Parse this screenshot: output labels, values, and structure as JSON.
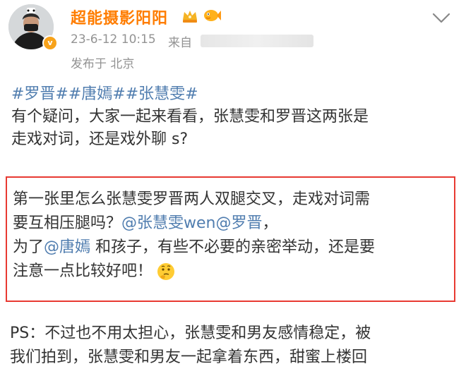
{
  "post": {
    "username": "超能摄影阳阳",
    "time": "23-6-12 10:15",
    "source_prefix": "来自",
    "location": "发布于 北京",
    "verified_mark": "v"
  },
  "content": {
    "topics": [
      "#罗晋#",
      "#唐嫣#",
      "#张慧雯#"
    ],
    "line1": "有个疑问，大家一起来看看，张慧雯和罗晋这两张是",
    "line2": "走戏对词，还是戏外聊 s?"
  },
  "highlight": {
    "line1": "第一张里怎么张慧雯罗晋两人双腿交叉，走戏对词需",
    "line2_prefix": "要互相压腿吗？",
    "mention1": "@张慧雯wen",
    "mention2": "@罗晋",
    "line2_suffix": "，",
    "line3_prefix": "为了",
    "mention3": "@唐嫣",
    "line3_suffix": " 和孩子，有些不必要的亲密举动，还是要",
    "line4": "注意一点比较好吧！"
  },
  "ps": {
    "line1": "PS：不过也不用太担心，张慧雯和男友感情稳定，被",
    "line2": "我们拍到，张慧雯和男友一起拿着东西，甜蜜上楼回"
  },
  "icons": {
    "avatar": "avatar-image",
    "badge": "verified-badge",
    "crown": "crown-icon",
    "fish": "fish-icon",
    "chevron": "chevron-down-icon",
    "thinking": "thinking-face-emoji"
  },
  "colors": {
    "username": "#ff7d00",
    "link": "#507daf",
    "meta": "#939393",
    "highlight_border": "#e83a32"
  }
}
